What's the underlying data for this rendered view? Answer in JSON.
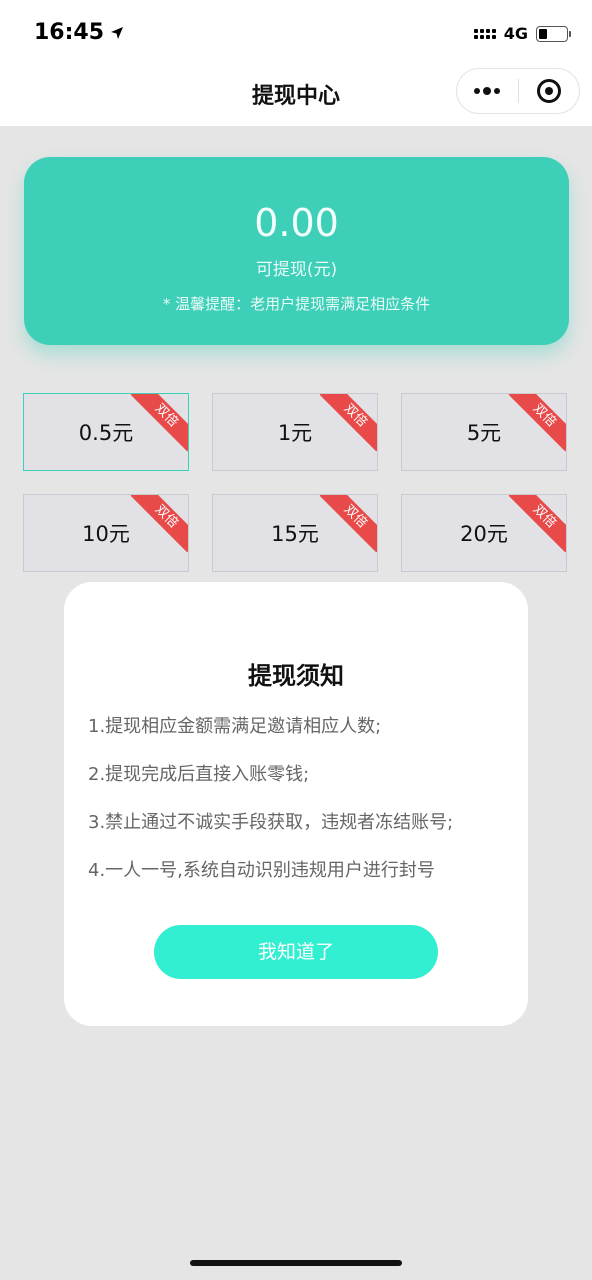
{
  "status_bar": {
    "time": "16:45",
    "network": "4G",
    "icons": [
      "location-arrow-icon",
      "signal-icon",
      "battery-icon"
    ]
  },
  "nav": {
    "title": "提现中心",
    "icons": [
      "more-dots-icon",
      "close-target-icon"
    ]
  },
  "balance": {
    "amount": "0.00",
    "label": "可提现(元)",
    "tip": "* 温馨提醒：老用户提现需满足相应条件"
  },
  "options": [
    {
      "label": "0.5元",
      "badge": "双倍",
      "selected": true
    },
    {
      "label": "1元",
      "badge": "双倍",
      "selected": false
    },
    {
      "label": "5元",
      "badge": "双倍",
      "selected": false
    },
    {
      "label": "10元",
      "badge": "双倍",
      "selected": false
    },
    {
      "label": "15元",
      "badge": "双倍",
      "selected": false
    },
    {
      "label": "20元",
      "badge": "双倍",
      "selected": false
    }
  ],
  "modal": {
    "title": "提现须知",
    "rules": [
      "1.提现相应金额需满足邀请相应人数;",
      "2.提现完成后直接入账零钱;",
      "3.禁止通过不诚实手段获取，违规者冻结账号;",
      "4.一人一号,系统自动识别违规用户进行封号"
    ],
    "button_label": "我知道了"
  },
  "colors": {
    "accent": "#3ecfb8",
    "button": "#33efd1",
    "badge": "#e84a4a",
    "page_bg": "#e5e5e5"
  }
}
